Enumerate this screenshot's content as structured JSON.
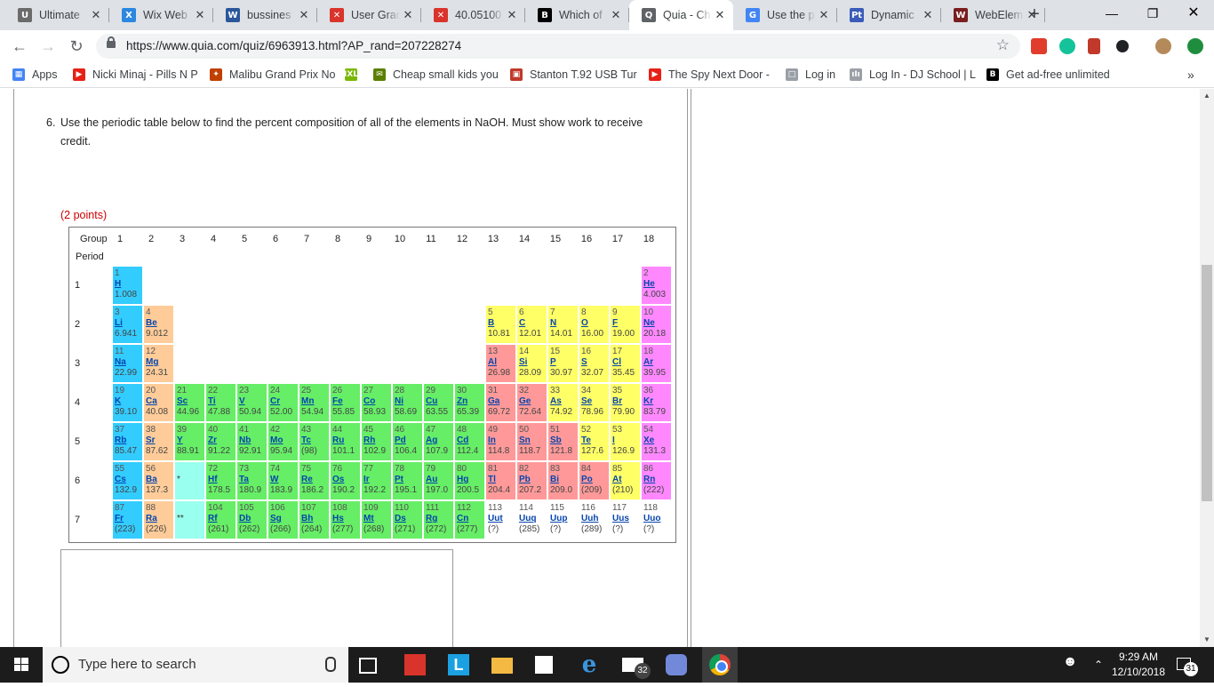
{
  "browser": {
    "tabs": [
      {
        "title": "Ultimate",
        "icon": "ultimate-guitar-icon",
        "color": "#6b6b6b",
        "glyph": "U"
      },
      {
        "title": "Wix Web",
        "icon": "wix-icon",
        "color": "#2b87e0",
        "glyph": "X"
      },
      {
        "title": "bussines",
        "icon": "word-icon",
        "color": "#2b579a",
        "glyph": "W"
      },
      {
        "title": "User Grad",
        "icon": "user-grad-icon",
        "color": "#d9342b",
        "glyph": "✕"
      },
      {
        "title": "40.05100",
        "icon": "doc-icon",
        "color": "#d9342b",
        "glyph": "✕"
      },
      {
        "title": "Which of",
        "icon": "brainly-icon",
        "color": "#000000",
        "glyph": "B"
      },
      {
        "title": "Quia - Ch",
        "icon": "quia-icon",
        "color": "#5f6368",
        "glyph": "Q"
      },
      {
        "title": "Use the p",
        "icon": "google-icon",
        "color": "#4285f4",
        "glyph": "G"
      },
      {
        "title": "Dynamic",
        "icon": "ptable-icon",
        "color": "#3b5cb8",
        "glyph": "Pt"
      },
      {
        "title": "WebElem",
        "icon": "webelements-icon",
        "color": "#7a1e1e",
        "glyph": "W"
      }
    ],
    "active_tab": 6,
    "url": "https://www.quia.com/quiz/6963913.html?AP_rand=207228274",
    "bookmarks": [
      {
        "label": "Apps",
        "icon": "apps-icon",
        "color": "#4285f4",
        "glyph": "▦"
      },
      {
        "label": "Nicki Minaj - Pills N P",
        "icon": "youtube-icon",
        "color": "#e62117",
        "glyph": "▶"
      },
      {
        "label": "Malibu Grand Prix No",
        "icon": "site-icon",
        "color": "#c04000",
        "glyph": "✦"
      },
      {
        "label": "",
        "icon": "ixl-icon",
        "color": "#7ab800",
        "glyph": "IXL"
      },
      {
        "label": "Cheap small kids you",
        "icon": "mail-icon",
        "color": "#5a7f00",
        "glyph": "✉"
      },
      {
        "label": "Stanton T.92 USB Tur",
        "icon": "stanton-icon",
        "color": "#c0392b",
        "glyph": "▣"
      },
      {
        "label": "The Spy Next Door -",
        "icon": "youtube-icon",
        "color": "#e62117",
        "glyph": "▶"
      },
      {
        "label": "Log in",
        "icon": "page-icon",
        "color": "#9aa0a6",
        "glyph": "□"
      },
      {
        "label": "Log In - DJ School | L",
        "icon": "dj-icon",
        "color": "#9aa0a6",
        "glyph": "ıIı"
      },
      {
        "label": "Get ad-free unlimited",
        "icon": "brainly-icon",
        "color": "#000000",
        "glyph": "B"
      }
    ]
  },
  "quiz": {
    "number": "6.",
    "question": "Use the periodic table below to find the percent composition of all of the elements in NaOH. Must show work to receive credit.",
    "points": "(2 points)",
    "table": {
      "group_label": "Group",
      "period_label": "Period",
      "groups": [
        "1",
        "2",
        "3",
        "4",
        "5",
        "6",
        "7",
        "8",
        "9",
        "10",
        "11",
        "12",
        "13",
        "14",
        "15",
        "16",
        "17",
        "18"
      ],
      "periods": [
        "1",
        "2",
        "3",
        "4",
        "5",
        "6",
        "7"
      ],
      "lanthanide_marker": "*",
      "actinide_marker": "**",
      "colors": {
        "alkali": "#33ccff",
        "alkaline": "#ffcc99",
        "transition": "#66ee66",
        "post": "#ff9999",
        "metalloid": "#ffff66",
        "nonmetal": "#ffff66",
        "noble": "#ff88ff",
        "lanth": "#99ffee",
        "unknown": "#ffffff"
      },
      "elements": [
        {
          "n": "1",
          "s": "H",
          "m": "1.008",
          "p": 1,
          "g": 1,
          "c": "alkali"
        },
        {
          "n": "2",
          "s": "He",
          "m": "4.003",
          "p": 1,
          "g": 18,
          "c": "noble"
        },
        {
          "n": "3",
          "s": "Li",
          "m": "6.941",
          "p": 2,
          "g": 1,
          "c": "alkali"
        },
        {
          "n": "4",
          "s": "Be",
          "m": "9.012",
          "p": 2,
          "g": 2,
          "c": "alkaline"
        },
        {
          "n": "5",
          "s": "B",
          "m": "10.81",
          "p": 2,
          "g": 13,
          "c": "metalloid"
        },
        {
          "n": "6",
          "s": "C",
          "m": "12.01",
          "p": 2,
          "g": 14,
          "c": "nonmetal"
        },
        {
          "n": "7",
          "s": "N",
          "m": "14.01",
          "p": 2,
          "g": 15,
          "c": "nonmetal"
        },
        {
          "n": "8",
          "s": "O",
          "m": "16.00",
          "p": 2,
          "g": 16,
          "c": "nonmetal"
        },
        {
          "n": "9",
          "s": "F",
          "m": "19.00",
          "p": 2,
          "g": 17,
          "c": "nonmetal"
        },
        {
          "n": "10",
          "s": "Ne",
          "m": "20.18",
          "p": 2,
          "g": 18,
          "c": "noble"
        },
        {
          "n": "11",
          "s": "Na",
          "m": "22.99",
          "p": 3,
          "g": 1,
          "c": "alkali"
        },
        {
          "n": "12",
          "s": "Mg",
          "m": "24.31",
          "p": 3,
          "g": 2,
          "c": "alkaline"
        },
        {
          "n": "13",
          "s": "Al",
          "m": "26.98",
          "p": 3,
          "g": 13,
          "c": "post"
        },
        {
          "n": "14",
          "s": "Si",
          "m": "28.09",
          "p": 3,
          "g": 14,
          "c": "metalloid"
        },
        {
          "n": "15",
          "s": "P",
          "m": "30.97",
          "p": 3,
          "g": 15,
          "c": "nonmetal"
        },
        {
          "n": "16",
          "s": "S",
          "m": "32.07",
          "p": 3,
          "g": 16,
          "c": "nonmetal"
        },
        {
          "n": "17",
          "s": "Cl",
          "m": "35.45",
          "p": 3,
          "g": 17,
          "c": "nonmetal"
        },
        {
          "n": "18",
          "s": "Ar",
          "m": "39.95",
          "p": 3,
          "g": 18,
          "c": "noble"
        },
        {
          "n": "19",
          "s": "K",
          "m": "39.10",
          "p": 4,
          "g": 1,
          "c": "alkali"
        },
        {
          "n": "20",
          "s": "Ca",
          "m": "40.08",
          "p": 4,
          "g": 2,
          "c": "alkaline"
        },
        {
          "n": "21",
          "s": "Sc",
          "m": "44.96",
          "p": 4,
          "g": 3,
          "c": "transition"
        },
        {
          "n": "22",
          "s": "Ti",
          "m": "47.88",
          "p": 4,
          "g": 4,
          "c": "transition"
        },
        {
          "n": "23",
          "s": "V",
          "m": "50.94",
          "p": 4,
          "g": 5,
          "c": "transition"
        },
        {
          "n": "24",
          "s": "Cr",
          "m": "52.00",
          "p": 4,
          "g": 6,
          "c": "transition"
        },
        {
          "n": "25",
          "s": "Mn",
          "m": "54.94",
          "p": 4,
          "g": 7,
          "c": "transition"
        },
        {
          "n": "26",
          "s": "Fe",
          "m": "55.85",
          "p": 4,
          "g": 8,
          "c": "transition"
        },
        {
          "n": "27",
          "s": "Co",
          "m": "58.93",
          "p": 4,
          "g": 9,
          "c": "transition"
        },
        {
          "n": "28",
          "s": "Ni",
          "m": "58.69",
          "p": 4,
          "g": 10,
          "c": "transition"
        },
        {
          "n": "29",
          "s": "Cu",
          "m": "63.55",
          "p": 4,
          "g": 11,
          "c": "transition"
        },
        {
          "n": "30",
          "s": "Zn",
          "m": "65.39",
          "p": 4,
          "g": 12,
          "c": "transition"
        },
        {
          "n": "31",
          "s": "Ga",
          "m": "69.72",
          "p": 4,
          "g": 13,
          "c": "post"
        },
        {
          "n": "32",
          "s": "Ge",
          "m": "72.64",
          "p": 4,
          "g": 14,
          "c": "post"
        },
        {
          "n": "33",
          "s": "As",
          "m": "74.92",
          "p": 4,
          "g": 15,
          "c": "metalloid"
        },
        {
          "n": "34",
          "s": "Se",
          "m": "78.96",
          "p": 4,
          "g": 16,
          "c": "nonmetal"
        },
        {
          "n": "35",
          "s": "Br",
          "m": "79.90",
          "p": 4,
          "g": 17,
          "c": "nonmetal"
        },
        {
          "n": "36",
          "s": "Kr",
          "m": "83.79",
          "p": 4,
          "g": 18,
          "c": "noble"
        },
        {
          "n": "37",
          "s": "Rb",
          "m": "85.47",
          "p": 5,
          "g": 1,
          "c": "alkali"
        },
        {
          "n": "38",
          "s": "Sr",
          "m": "87.62",
          "p": 5,
          "g": 2,
          "c": "alkaline"
        },
        {
          "n": "39",
          "s": "Y",
          "m": "88.91",
          "p": 5,
          "g": 3,
          "c": "transition"
        },
        {
          "n": "40",
          "s": "Zr",
          "m": "91.22",
          "p": 5,
          "g": 4,
          "c": "transition"
        },
        {
          "n": "41",
          "s": "Nb",
          "m": "92.91",
          "p": 5,
          "g": 5,
          "c": "transition"
        },
        {
          "n": "42",
          "s": "Mo",
          "m": "95.94",
          "p": 5,
          "g": 6,
          "c": "transition"
        },
        {
          "n": "43",
          "s": "Tc",
          "m": "(98)",
          "p": 5,
          "g": 7,
          "c": "transition"
        },
        {
          "n": "44",
          "s": "Ru",
          "m": "101.1",
          "p": 5,
          "g": 8,
          "c": "transition"
        },
        {
          "n": "45",
          "s": "Rh",
          "m": "102.9",
          "p": 5,
          "g": 9,
          "c": "transition"
        },
        {
          "n": "46",
          "s": "Pd",
          "m": "106.4",
          "p": 5,
          "g": 10,
          "c": "transition"
        },
        {
          "n": "47",
          "s": "Ag",
          "m": "107.9",
          "p": 5,
          "g": 11,
          "c": "transition"
        },
        {
          "n": "48",
          "s": "Cd",
          "m": "112.4",
          "p": 5,
          "g": 12,
          "c": "transition"
        },
        {
          "n": "49",
          "s": "In",
          "m": "114.8",
          "p": 5,
          "g": 13,
          "c": "post"
        },
        {
          "n": "50",
          "s": "Sn",
          "m": "118.7",
          "p": 5,
          "g": 14,
          "c": "post"
        },
        {
          "n": "51",
          "s": "Sb",
          "m": "121.8",
          "p": 5,
          "g": 15,
          "c": "post"
        },
        {
          "n": "52",
          "s": "Te",
          "m": "127.6",
          "p": 5,
          "g": 16,
          "c": "metalloid"
        },
        {
          "n": "53",
          "s": "I",
          "m": "126.9",
          "p": 5,
          "g": 17,
          "c": "nonmetal"
        },
        {
          "n": "54",
          "s": "Xe",
          "m": "131.3",
          "p": 5,
          "g": 18,
          "c": "noble"
        },
        {
          "n": "55",
          "s": "Cs",
          "m": "132.9",
          "p": 6,
          "g": 1,
          "c": "alkali"
        },
        {
          "n": "56",
          "s": "Ba",
          "m": "137.3",
          "p": 6,
          "g": 2,
          "c": "alkaline"
        },
        {
          "n": "72",
          "s": "Hf",
          "m": "178.5",
          "p": 6,
          "g": 4,
          "c": "transition"
        },
        {
          "n": "73",
          "s": "Ta",
          "m": "180.9",
          "p": 6,
          "g": 5,
          "c": "transition"
        },
        {
          "n": "74",
          "s": "W",
          "m": "183.9",
          "p": 6,
          "g": 6,
          "c": "transition"
        },
        {
          "n": "75",
          "s": "Re",
          "m": "186.2",
          "p": 6,
          "g": 7,
          "c": "transition"
        },
        {
          "n": "76",
          "s": "Os",
          "m": "190.2",
          "p": 6,
          "g": 8,
          "c": "transition"
        },
        {
          "n": "77",
          "s": "Ir",
          "m": "192.2",
          "p": 6,
          "g": 9,
          "c": "transition"
        },
        {
          "n": "78",
          "s": "Pt",
          "m": "195.1",
          "p": 6,
          "g": 10,
          "c": "transition"
        },
        {
          "n": "79",
          "s": "Au",
          "m": "197.0",
          "p": 6,
          "g": 11,
          "c": "transition"
        },
        {
          "n": "80",
          "s": "Hg",
          "m": "200.5",
          "p": 6,
          "g": 12,
          "c": "transition"
        },
        {
          "n": "81",
          "s": "Tl",
          "m": "204.4",
          "p": 6,
          "g": 13,
          "c": "post"
        },
        {
          "n": "82",
          "s": "Pb",
          "m": "207.2",
          "p": 6,
          "g": 14,
          "c": "post"
        },
        {
          "n": "83",
          "s": "Bi",
          "m": "209.0",
          "p": 6,
          "g": 15,
          "c": "post"
        },
        {
          "n": "84",
          "s": "Po",
          "m": "(209)",
          "p": 6,
          "g": 16,
          "c": "post"
        },
        {
          "n": "85",
          "s": "At",
          "m": "(210)",
          "p": 6,
          "g": 17,
          "c": "metalloid"
        },
        {
          "n": "86",
          "s": "Rn",
          "m": "(222)",
          "p": 6,
          "g": 18,
          "c": "noble"
        },
        {
          "n": "87",
          "s": "Fr",
          "m": "(223)",
          "p": 7,
          "g": 1,
          "c": "alkali"
        },
        {
          "n": "88",
          "s": "Ra",
          "m": "(226)",
          "p": 7,
          "g": 2,
          "c": "alkaline"
        },
        {
          "n": "104",
          "s": "Rf",
          "m": "(261)",
          "p": 7,
          "g": 4,
          "c": "transition"
        },
        {
          "n": "105",
          "s": "Db",
          "m": "(262)",
          "p": 7,
          "g": 5,
          "c": "transition"
        },
        {
          "n": "106",
          "s": "Sg",
          "m": "(266)",
          "p": 7,
          "g": 6,
          "c": "transition"
        },
        {
          "n": "107",
          "s": "Bh",
          "m": "(264)",
          "p": 7,
          "g": 7,
          "c": "transition"
        },
        {
          "n": "108",
          "s": "Hs",
          "m": "(277)",
          "p": 7,
          "g": 8,
          "c": "transition"
        },
        {
          "n": "109",
          "s": "Mt",
          "m": "(268)",
          "p": 7,
          "g": 9,
          "c": "transition"
        },
        {
          "n": "110",
          "s": "Ds",
          "m": "(271)",
          "p": 7,
          "g": 10,
          "c": "transition"
        },
        {
          "n": "111",
          "s": "Rg",
          "m": "(272)",
          "p": 7,
          "g": 11,
          "c": "transition"
        },
        {
          "n": "112",
          "s": "Cn",
          "m": "(277)",
          "p": 7,
          "g": 12,
          "c": "transition"
        },
        {
          "n": "113",
          "s": "Uut",
          "m": "(?)",
          "p": 7,
          "g": 13,
          "c": "unknown"
        },
        {
          "n": "114",
          "s": "Uuq",
          "m": "(285)",
          "p": 7,
          "g": 14,
          "c": "unknown"
        },
        {
          "n": "115",
          "s": "Uup",
          "m": "(?)",
          "p": 7,
          "g": 15,
          "c": "unknown"
        },
        {
          "n": "116",
          "s": "Uuh",
          "m": "(289)",
          "p": 7,
          "g": 16,
          "c": "unknown"
        },
        {
          "n": "117",
          "s": "Uus",
          "m": "(?)",
          "p": 7,
          "g": 17,
          "c": "unknown"
        },
        {
          "n": "118",
          "s": "Uuo",
          "m": "(?)",
          "p": 7,
          "g": 18,
          "c": "unknown"
        }
      ]
    }
  },
  "taskbar": {
    "search_placeholder": "Type here to search",
    "mail_badge": "32",
    "time": "9:29 AM",
    "date": "12/10/2018",
    "notification_count": "31"
  }
}
